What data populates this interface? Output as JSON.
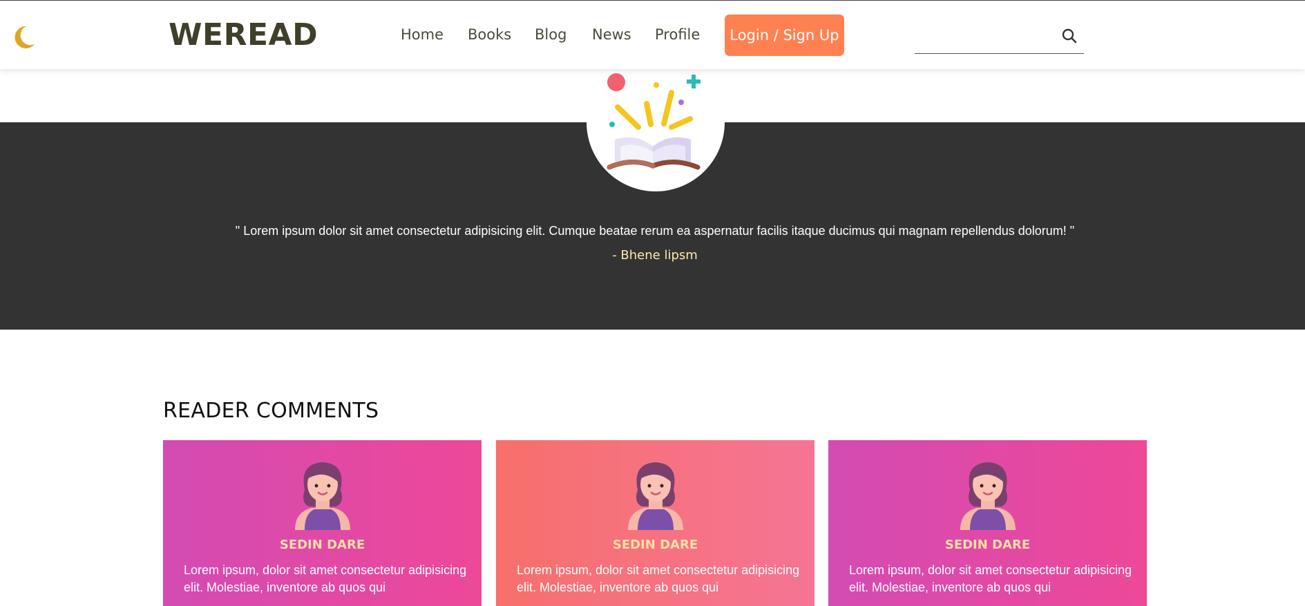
{
  "header": {
    "logo": "WEREAD",
    "nav": [
      {
        "label": "Home"
      },
      {
        "label": "Books"
      },
      {
        "label": "Blog"
      },
      {
        "label": "News"
      },
      {
        "label": "Profile"
      }
    ],
    "login_label": "Login / Sign Up",
    "search_value": "",
    "icons": {
      "theme_toggle": "moon-icon",
      "search": "search-icon"
    }
  },
  "testimonial": {
    "quote": "\" Lorem ipsum dolor sit amet consectetur adipisicing elit. Cumque beatae rerum ea aspernatur facilis itaque ducimus qui magnam repellendus dolorum! \"",
    "author": "- Bhene lipsm",
    "icon": "open-book-icon"
  },
  "comments": {
    "title": "READER COMMENTS",
    "cards": [
      {
        "name": "SEDIN DARE",
        "text": "Lorem ipsum, dolor sit amet consectetur adipisicing elit. Molestiae, inventore ab quos qui"
      },
      {
        "name": "SEDIN DARE",
        "text": "Lorem ipsum, dolor sit amet consectetur adipisicing elit. Molestiae, inventore ab quos qui"
      },
      {
        "name": "SEDIN DARE",
        "text": "Lorem ipsum, dolor sit amet consectetur adipisicing elit. Molestiae, inventore ab quos qui"
      }
    ]
  },
  "colors": {
    "accent": "#ff8152",
    "band": "#333333",
    "logo": "#3f3f2a",
    "moon": "#e0a526",
    "card_pink_start": "#d34bb3",
    "card_pink_end": "#ee4898",
    "card_coral_start": "#f7706b",
    "card_coral_end": "#f57495"
  }
}
